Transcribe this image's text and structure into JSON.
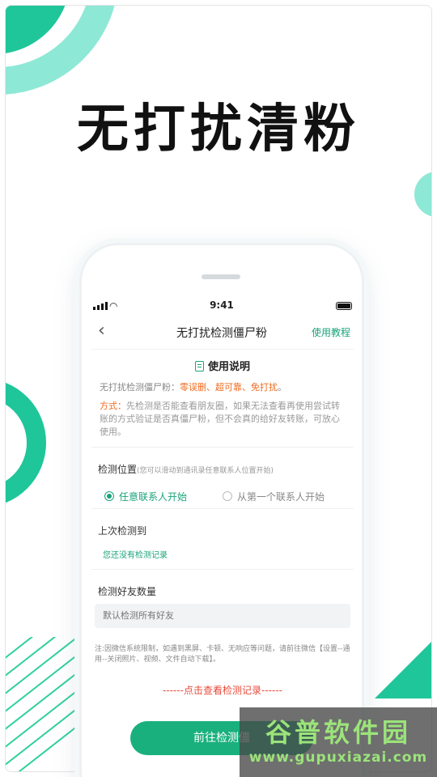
{
  "headline": "无打扰清粉",
  "status_bar": {
    "time": "9:41"
  },
  "nav": {
    "back_glyph": "‹",
    "title": "无打扰检测僵尸粉",
    "help_link": "使用教程"
  },
  "instructions": {
    "title": "使用说明",
    "line1_prefix": "无打扰检测僵尸粉：",
    "line1_highlight": "零误删、超可靠、免打扰",
    "line1_suffix": "。",
    "method_label": "方式：",
    "method_text": "先检测是否能查看朋友圈，如果无法查看再使用尝试转账的方式验证是否真僵尸粉，但不会真的给好友转账，可放心使用。"
  },
  "position": {
    "title": "检测位置",
    "hint": "(您可以滑动到通讯录任意联系人位置开始)",
    "options": [
      {
        "label": "任意联系人开始",
        "selected": true
      },
      {
        "label": "从第一个联系人开始",
        "selected": false
      }
    ]
  },
  "last_check": {
    "title": "上次检测到",
    "value": "您还没有检测记录"
  },
  "friend_count": {
    "title": "检测好友数量",
    "placeholder": "默认检测所有好友"
  },
  "note": "注:因微信系统限制，如遇到黑屏、卡顿、无响应等问题，请前往微信【设置--通用--关闭照片、视频、文件自动下载】。",
  "view_record": "------点击查看检测记录------",
  "primary_button": "前往检测僵",
  "watermark": {
    "title": "谷普软件园",
    "url": "www.gupuxiazai.com"
  },
  "colors": {
    "accent": "#1aa37a",
    "button": "#1ab07e",
    "highlight": "#ef6b1f",
    "link_red": "#e84a3a",
    "deco_dark": "#1fc69a",
    "deco_light": "#8ee8d6"
  },
  "icons": [
    "back-chevron-icon",
    "document-icon",
    "signal-icon",
    "wifi-icon",
    "battery-icon"
  ]
}
